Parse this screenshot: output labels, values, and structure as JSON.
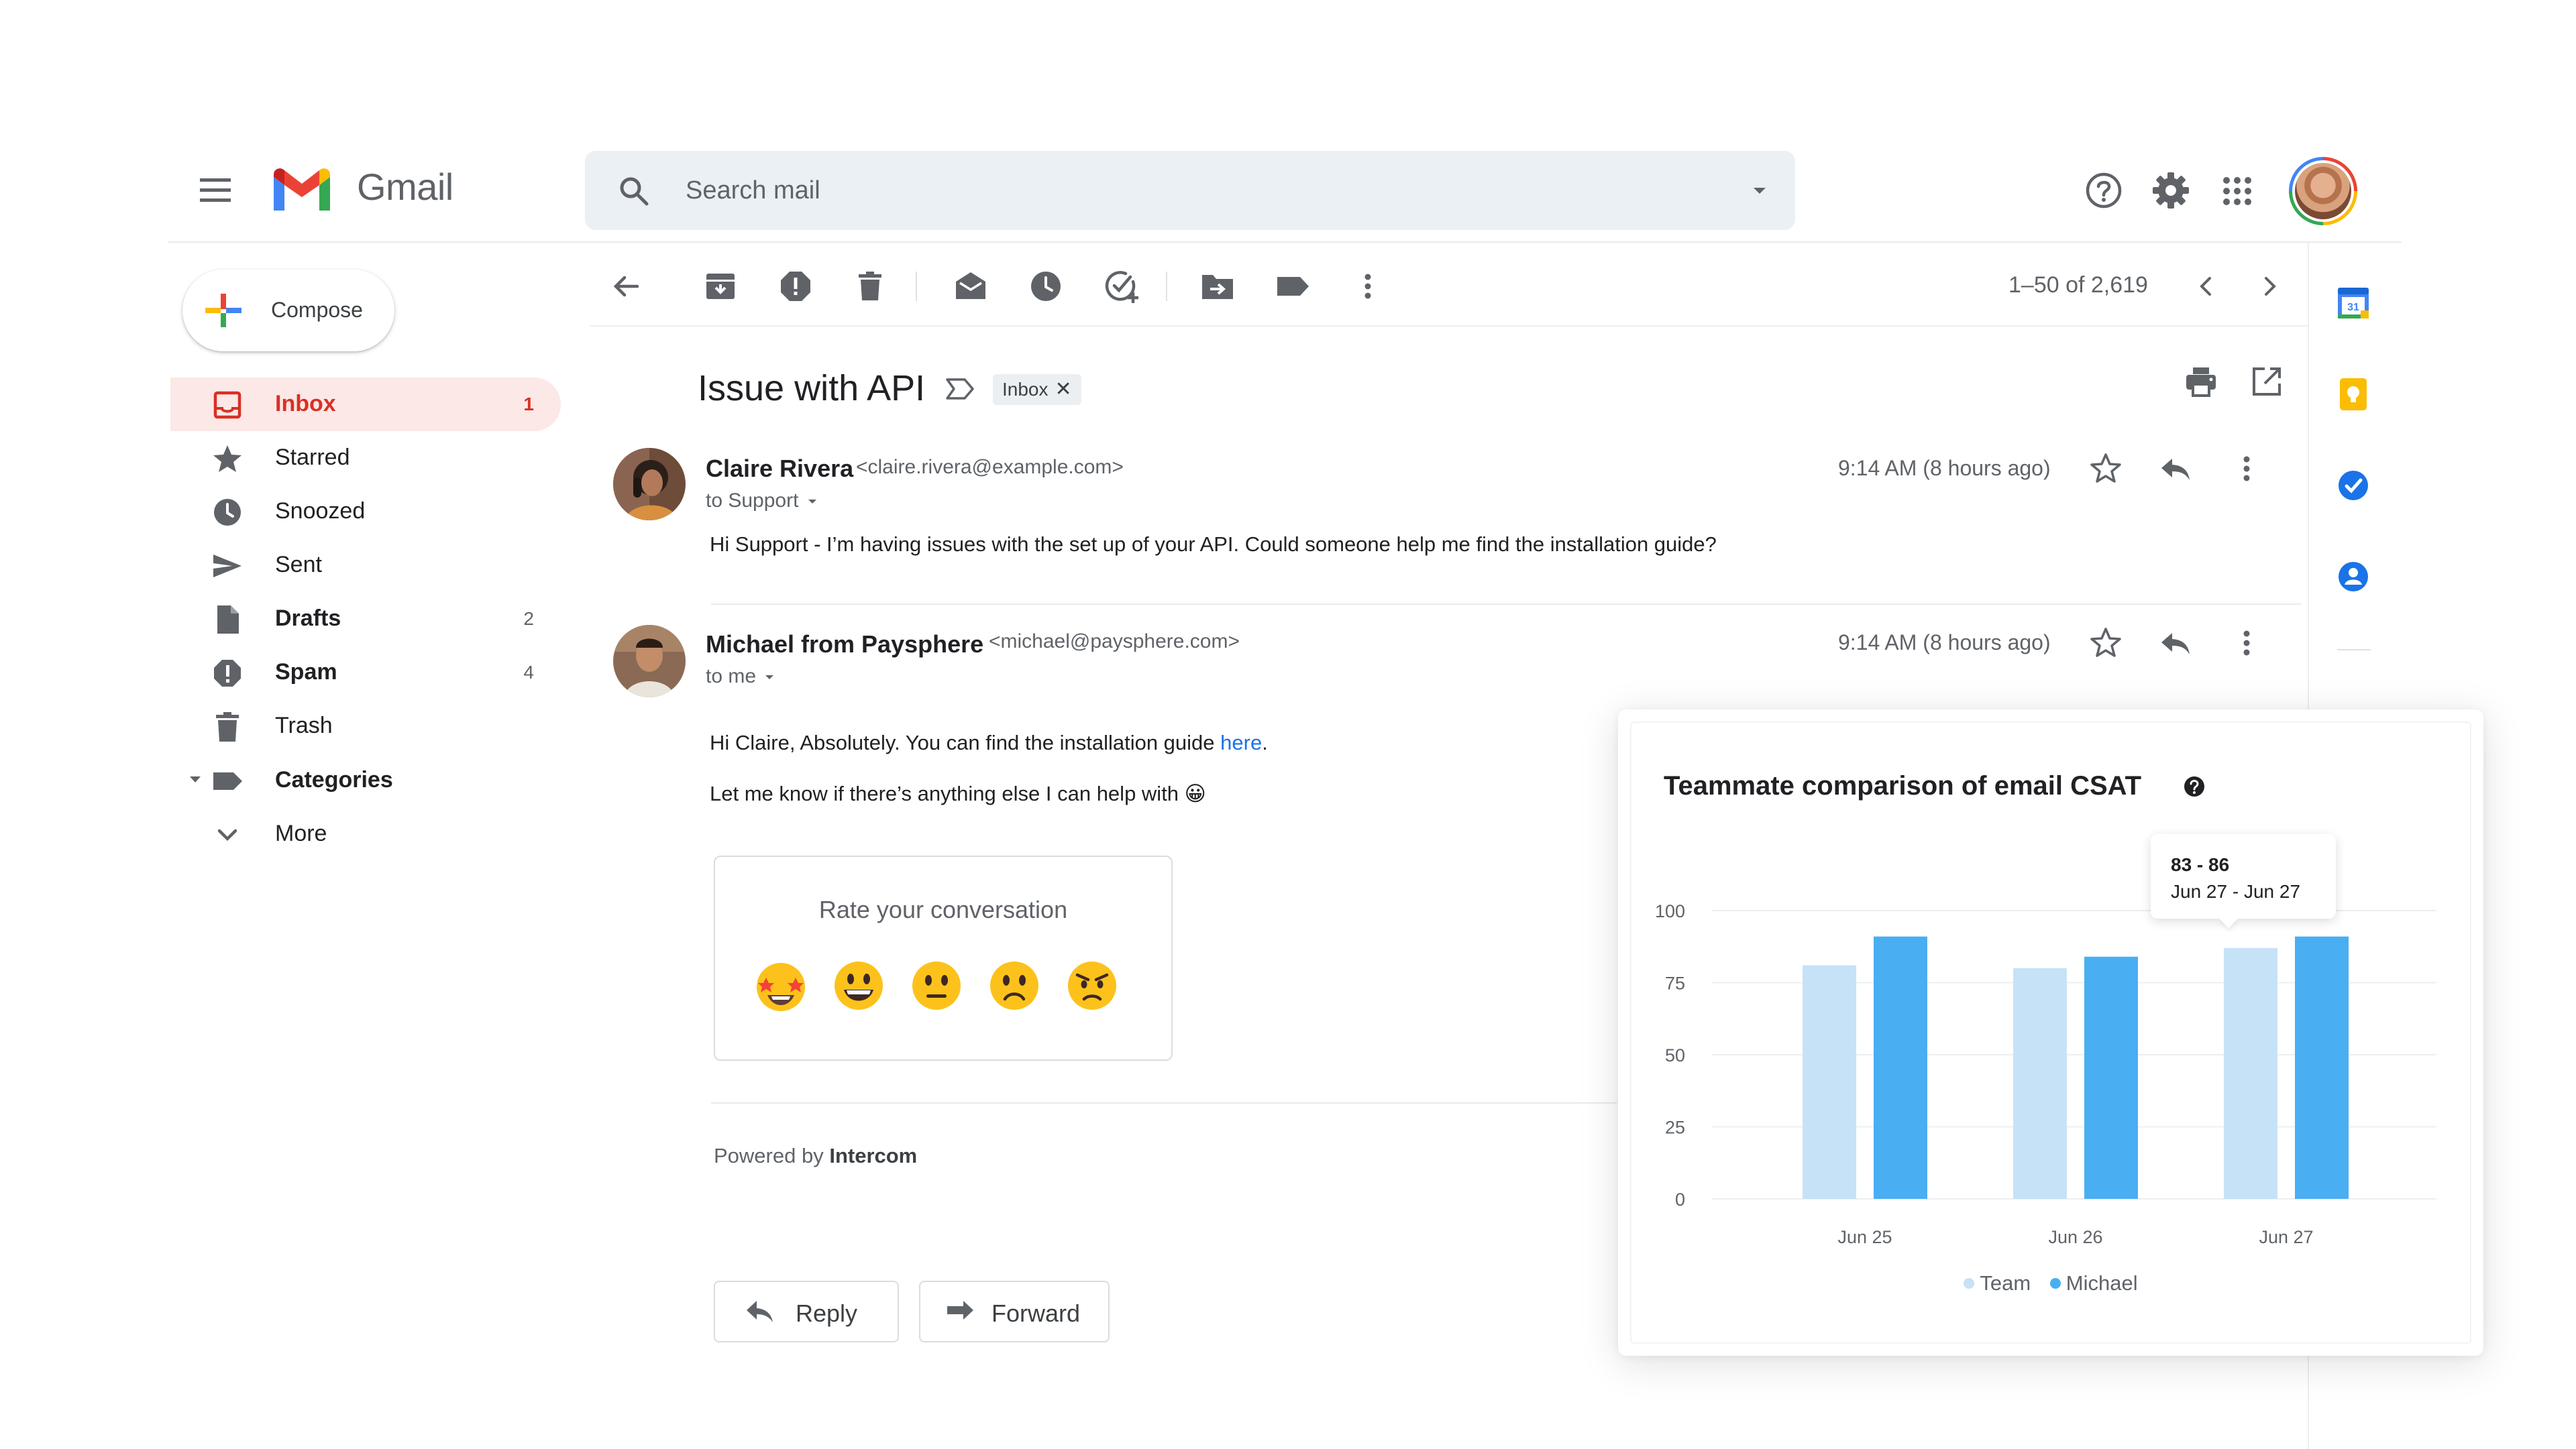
{
  "app": {
    "name": "Gmail"
  },
  "search": {
    "placeholder": "Search mail"
  },
  "compose": {
    "label": "Compose"
  },
  "sidebar": {
    "items": [
      {
        "label": "Inbox",
        "count": "1",
        "icon": "inbox-icon"
      },
      {
        "label": "Starred",
        "count": "",
        "icon": "star-icon"
      },
      {
        "label": "Snoozed",
        "count": "",
        "icon": "clock-icon"
      },
      {
        "label": "Sent",
        "count": "",
        "icon": "send-icon"
      },
      {
        "label": "Drafts",
        "count": "2",
        "icon": "draft-icon"
      },
      {
        "label": "Spam",
        "count": "4",
        "icon": "spam-icon"
      },
      {
        "label": "Trash",
        "count": "",
        "icon": "trash-icon"
      },
      {
        "label": "Categories",
        "count": "",
        "icon": "label-icon"
      },
      {
        "label": "More",
        "count": "",
        "icon": "chevron-down-icon"
      }
    ]
  },
  "toolbar": {
    "pagination": "1–50 of 2,619"
  },
  "thread": {
    "subject": "Issue with API",
    "label_chip": "Inbox",
    "messages": [
      {
        "sender": "Claire Rivera",
        "email": "<claire.rivera@example.com>",
        "to": "to Support",
        "time": "9:14 AM (8 hours ago)",
        "body": "Hi Support - I’m having issues with the set up of your API. Could someone help me find the installation guide?"
      },
      {
        "sender": "Michael from Paysphere",
        "email": "<michael@paysphere.com>",
        "to": "to me",
        "time": "9:14 AM (8 hours ago)",
        "body_line1_prefix": "Hi Claire, Absolutely. You can find the installation guide ",
        "body_line1_link": "here",
        "body_line1_suffix": ".",
        "body_line2": "Let me know if there’s anything else I can help with 😀"
      }
    ],
    "rating": {
      "title": "Rate your conversation"
    },
    "powered_by_prefix": "Powered by ",
    "powered_by_brand": "Intercom",
    "reply_label": "Reply",
    "forward_label": "Forward"
  },
  "colors": {
    "team": "#c6e2f7",
    "michael": "#4aaef2",
    "inbox_accent": "#d93025",
    "link": "#1a73e8"
  },
  "chart_data": {
    "type": "bar",
    "title": "Teammate comparison of email CSAT",
    "categories": [
      "Jun 25",
      "Jun 26",
      "Jun 27"
    ],
    "series": [
      {
        "name": "Team",
        "values": [
          81,
          80,
          87
        ]
      },
      {
        "name": "Michael",
        "values": [
          91,
          84,
          91
        ]
      }
    ],
    "yticks": [
      "0",
      "25",
      "50",
      "75",
      "100"
    ],
    "ylim": [
      0,
      100
    ],
    "tooltip": {
      "range": "83 - 86",
      "dates": "Jun 27 - Jun 27"
    },
    "legend": "bottom",
    "grid": true
  }
}
